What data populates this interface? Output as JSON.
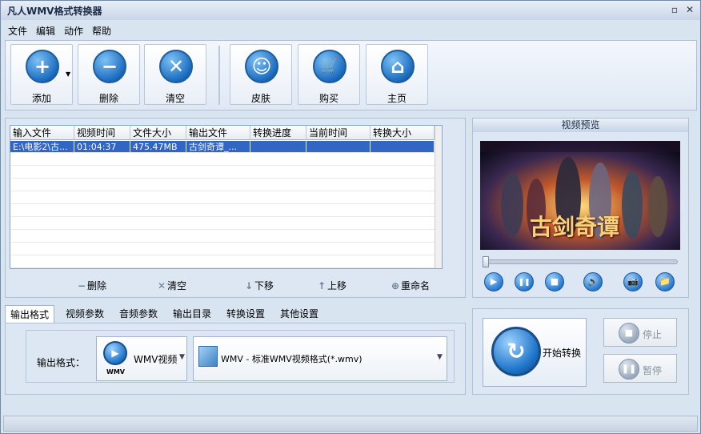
{
  "window": {
    "title": "凡人WMV格式转换器",
    "min": "▫",
    "close": "✕"
  },
  "menu": [
    "文件",
    "编辑",
    "动作",
    "帮助"
  ],
  "toolbar": [
    {
      "label": "添加",
      "glyph": "+"
    },
    {
      "label": "删除",
      "glyph": "−"
    },
    {
      "label": "清空",
      "glyph": "✕"
    },
    {
      "label": "皮肤",
      "glyph": "☺"
    },
    {
      "label": "购买",
      "glyph": "🛒"
    },
    {
      "label": "主页",
      "glyph": "⌂"
    }
  ],
  "list": {
    "columns": [
      "输入文件",
      "视频时间",
      "文件大小",
      "输出文件",
      "转换进度",
      "当前时间",
      "转换大小"
    ],
    "rows": [
      [
        "E:\\电影2\\古...",
        "01:04:37",
        "475.47MB",
        "古剑奇谭_...",
        "",
        "",
        ""
      ]
    ]
  },
  "actions": [
    {
      "icon": "−",
      "label": "删除"
    },
    {
      "icon": "✕",
      "label": "清空"
    },
    {
      "icon": "↓",
      "label": "下移"
    },
    {
      "icon": "↑",
      "label": "上移"
    },
    {
      "icon": "⊕",
      "label": "重命名"
    }
  ],
  "preview": {
    "title": "视频预览",
    "overlay_text": "古剑奇谭",
    "controls": [
      "▶",
      "❚❚",
      "■",
      "🔊",
      "📷",
      "📁"
    ]
  },
  "tabs": [
    "输出格式",
    "视频参数",
    "音频参数",
    "输出目录",
    "转换设置",
    "其他设置"
  ],
  "format": {
    "label": "输出格式：",
    "type_value": "WMV视频",
    "type_badge": "WMV",
    "profile_value": "WMV - 标准WMV视频格式(*.wmv)"
  },
  "convert": {
    "start": "开始转换",
    "stop": "停止",
    "pause": "暂停"
  }
}
